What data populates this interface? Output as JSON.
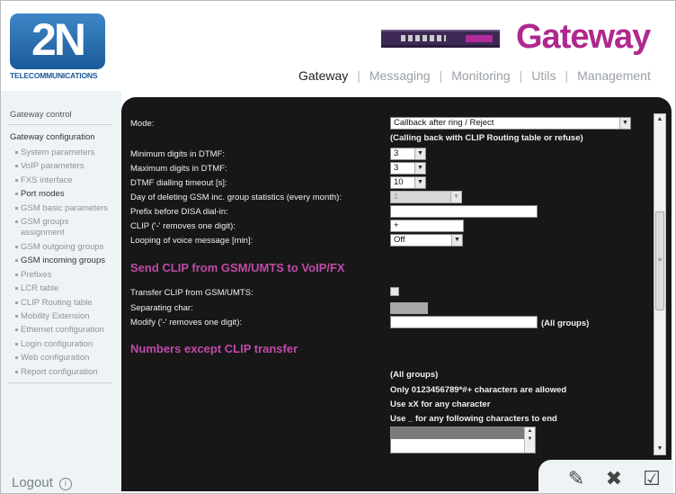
{
  "header": {
    "logo_text": "2N",
    "logo_sub": "TELECOMMUNICATIONS",
    "brand": "Gateway",
    "nav": [
      {
        "label": "Gateway",
        "active": true
      },
      {
        "label": "Messaging",
        "active": false
      },
      {
        "label": "Monitoring",
        "active": false
      },
      {
        "label": "Utils",
        "active": false
      },
      {
        "label": "Management",
        "active": false
      }
    ]
  },
  "sidebar": {
    "gateway_control": "Gateway control",
    "gateway_configuration": "Gateway configuration",
    "items": [
      {
        "label": "System parameters",
        "active": false
      },
      {
        "label": "VoIP parameters",
        "active": false
      },
      {
        "label": "FXS interface",
        "active": false
      },
      {
        "label": "Port modes",
        "active": true
      },
      {
        "label": "GSM basic parameters",
        "active": false
      },
      {
        "label": "GSM groups assignment",
        "active": false
      },
      {
        "label": "GSM outgoing groups",
        "active": false
      },
      {
        "label": "GSM incoming groups",
        "active": true
      },
      {
        "label": "Prefixes",
        "active": false
      },
      {
        "label": "LCR table",
        "active": false
      },
      {
        "label": "CLIP Routing table",
        "active": false
      },
      {
        "label": "Mobility Extension",
        "active": false
      },
      {
        "label": "Ethernet configuration",
        "active": false
      },
      {
        "label": "Login configuration",
        "active": false
      },
      {
        "label": "Web configuration",
        "active": false
      },
      {
        "label": "Report configuration",
        "active": false
      }
    ],
    "logout": "Logout"
  },
  "form": {
    "mode_label": "Mode:",
    "mode_value": "Callback after ring / Reject",
    "mode_note": "(Calling back with CLIP Routing table or refuse)",
    "min_digits_label": "Minimum digits in DTMF:",
    "min_digits_value": "3",
    "max_digits_label": "Maximum digits in DTMF:",
    "max_digits_value": "3",
    "timeout_label": "DTMF dialling timeout [s]:",
    "timeout_value": "10",
    "day_label": "Day of deleting GSM inc. group statistics (every month):",
    "day_value": "1",
    "prefix_label": "Prefix before DISA dial-in:",
    "prefix_value": "",
    "clip_label": "CLIP ('-' removes one digit):",
    "clip_value": "+",
    "loop_label": "Looping of voice message [min]:",
    "loop_value": "Off",
    "section_send_clip": "Send CLIP from GSM/UMTS to VoIP/FX",
    "transfer_label": "Transfer CLIP from GSM/UMTS:",
    "separating_label": "Separating char:",
    "modify_label": "Modify ('-' removes one digit):",
    "modify_value": "",
    "modify_note": "(All groups)",
    "section_numbers": "Numbers except CLIP transfer",
    "all_groups_note": "(All groups)",
    "hint_1": "Only 0123456789*#+ characters are allowed",
    "hint_2": "Use xX for any character",
    "hint_3": "Use _ for any following characters to end"
  },
  "icons": {
    "dropdown": "chevron-down-icon",
    "logout": "power-icon",
    "edit": "edit-document-icon",
    "delete": "delete-document-icon",
    "save": "checklist-icon"
  }
}
